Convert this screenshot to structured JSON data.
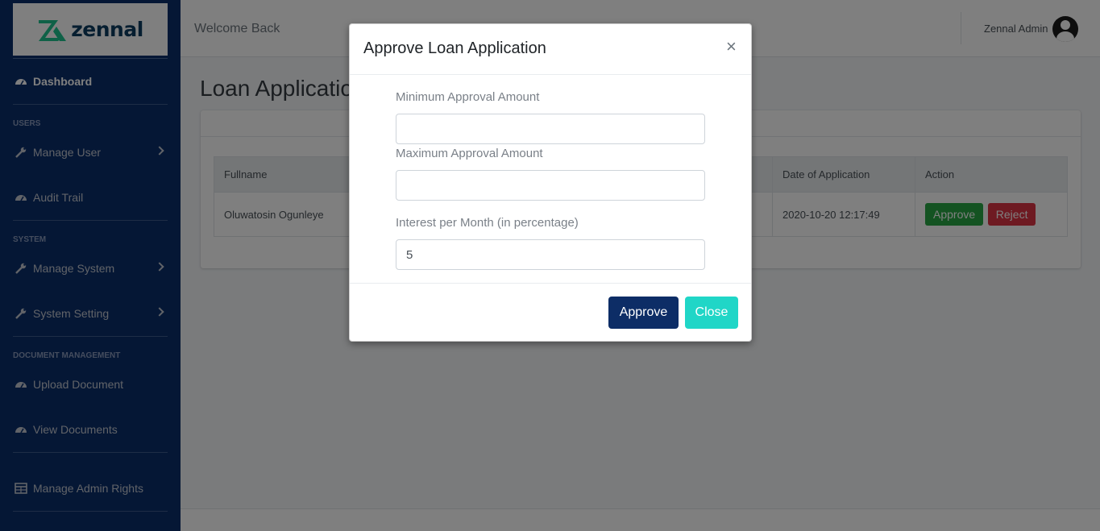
{
  "brand": {
    "name": "zennal",
    "accent": "#1fc28f"
  },
  "topbar": {
    "welcome": "Welcome Back",
    "user_name": "Zennal Admin"
  },
  "sidebar": {
    "dashboard": "Dashboard",
    "section_users": "USERS",
    "manage_user": "Manage User",
    "audit_trail": "Audit Trail",
    "section_system": "SYSTEM",
    "manage_system": "Manage System",
    "system_setting": "System Setting",
    "section_documents": "DOCUMENT MANAGEMENT",
    "upload_document": "Upload Document",
    "view_documents": "View Documents",
    "manage_admin_rights": "Manage Admin Rights"
  },
  "page": {
    "title": "Loan Applications"
  },
  "table": {
    "headers": {
      "fullname": "Fullname",
      "date": "Date of Application",
      "action": "Action"
    },
    "rows": [
      {
        "fullname": "Oluwatosin Ogunleye",
        "date": "2020-10-20 12:17:49",
        "approve": "Approve",
        "reject": "Reject"
      }
    ]
  },
  "modal": {
    "title": "Approve Loan Application",
    "close_symbol": "×",
    "min_label": "Minimum Approval Amount",
    "min_value": "",
    "max_label": "Maximum Approval Amount",
    "max_value": "",
    "interest_label": "Interest per Month (in percentage)",
    "interest_value": "5",
    "approve_label": "Approve",
    "close_label": "Close"
  }
}
